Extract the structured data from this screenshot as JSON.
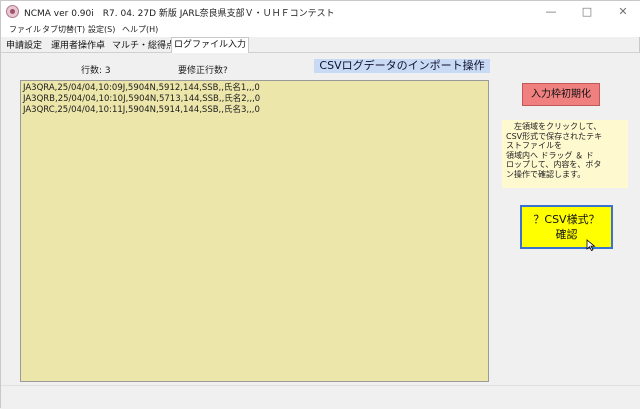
{
  "window": {
    "title": "NCMA ver 0.90i　R7. 04. 27D 新版 JARL奈良県支部Ｖ・ＵＨＦコンテスト",
    "minimize_icon": "minimize-icon",
    "maximize_icon": "maximize-icon",
    "close_icon": "close-icon"
  },
  "menu": {
    "items": [
      "ファイル",
      "タブ切替(T)",
      "設定(S)",
      "ヘルプ(H)"
    ]
  },
  "tabs": {
    "items": [
      "申請設定",
      "運用者操作卓",
      "マルチ・総得点",
      "ログファイル入力"
    ],
    "active_index": 3
  },
  "import": {
    "row_count_label": "行数: 3",
    "fix_rows_label": "要修正行数?",
    "title": "CSVログデータのインポート操作",
    "lines": [
      "JA3QRA,25/04/04,10:09J,5904N,5912,144,SSB,,氏名1,,,0",
      "JA3QRB,25/04/04,10:10J,5904N,5713,144,SSB,,氏名2,,,0",
      "JA3QRC,25/04/04,10:11J,5904N,5914,144,SSB,,氏名3,,,0"
    ],
    "reset_button": "入力枠初期化",
    "hint_lines": [
      "　左領域をクリックして、",
      "CSV形式で保存されたテキ",
      "ストファイルを",
      "領域内へ ドラッグ ＆ ド",
      "ロップして、内容を、ボタ",
      "ン操作で確認します。"
    ],
    "confirm_button_line1": "？CSV様式？",
    "confirm_button_line2": "確認"
  },
  "colors": {
    "data_area": "#ece6aa",
    "reset_button": "#f08080",
    "confirm_button": "#ffff00",
    "title_highlight": "#c8daf4",
    "hint_background": "#fff9d0"
  }
}
